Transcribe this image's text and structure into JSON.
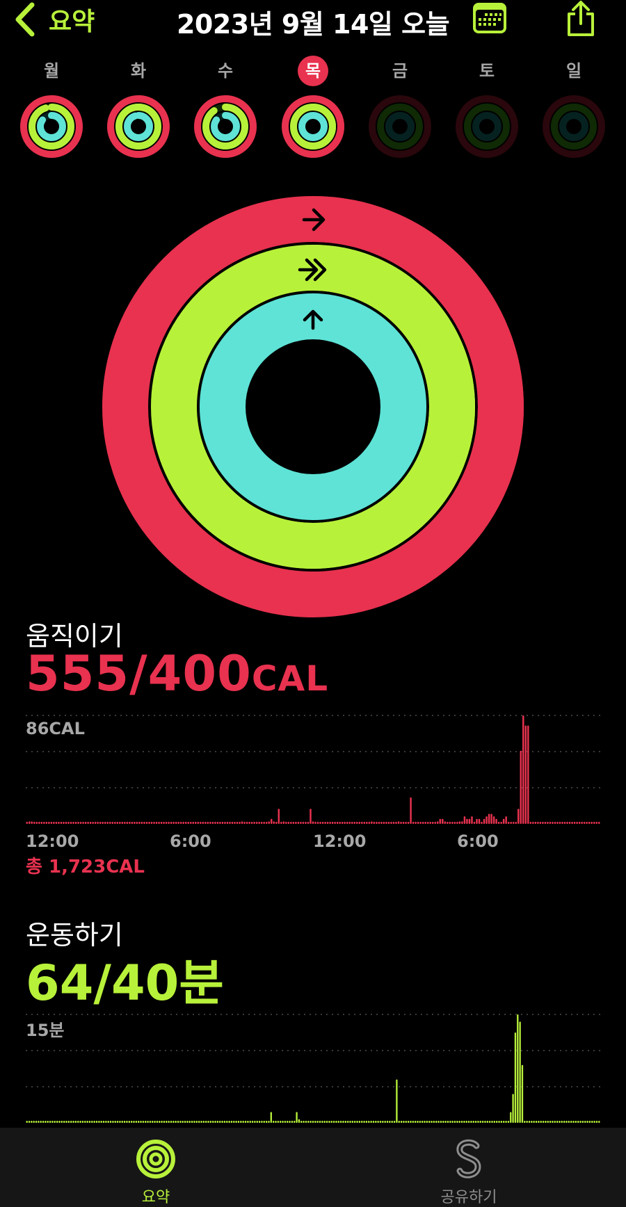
{
  "header": {
    "back_label": "요약",
    "title": "2023년 9월 14일 오늘"
  },
  "week": [
    {
      "label": "월",
      "today": false,
      "move": 1.05,
      "exercise": 0.95,
      "stand": 0.85
    },
    {
      "label": "화",
      "today": false,
      "move": 1.1,
      "exercise": 1.05,
      "stand": 0.95
    },
    {
      "label": "수",
      "today": false,
      "move": 1.05,
      "exercise": 0.9,
      "stand": 0.85
    },
    {
      "label": "목",
      "today": true,
      "move": 1.39,
      "exercise": 1.6,
      "stand": 1.0
    },
    {
      "label": "금",
      "today": false,
      "move": 0,
      "exercise": 0,
      "stand": 0
    },
    {
      "label": "토",
      "today": false,
      "move": 0,
      "exercise": 0,
      "stand": 0
    },
    {
      "label": "일",
      "today": false,
      "move": 0,
      "exercise": 0,
      "stand": 0
    }
  ],
  "rings": {
    "move": 1.39,
    "exercise": 1.6,
    "stand": 1.0
  },
  "colors": {
    "move": "#e8324f",
    "exercise": "#b8f13a",
    "stand": "#5ee3d6",
    "move_dim": "#2a070c",
    "exercise_dim": "#0f2a05",
    "stand_dim": "#062220",
    "tick_text": "#a8a8a8"
  },
  "move": {
    "label": "움직이기",
    "value": "555/400",
    "unit": "CAL",
    "chart_max_label": "86CAL",
    "ticks": [
      "12:00",
      "6:00",
      "12:00",
      "6:00"
    ],
    "total": "총 1,723CAL"
  },
  "exercise": {
    "label": "운동하기",
    "value": "64/40분",
    "chart_max_label": "15분"
  },
  "chart_data": [
    {
      "type": "bar",
      "title": "",
      "ylabel": "",
      "ymax": 86,
      "categories": [
        "12:00",
        "6:00",
        "12:00",
        "6:00"
      ],
      "values": [
        1,
        2,
        2,
        1,
        1,
        1,
        1,
        1,
        1,
        1,
        1,
        1,
        1,
        1,
        1,
        1,
        1,
        1,
        1,
        1,
        1,
        1,
        1,
        1,
        1,
        1,
        1,
        1,
        1,
        1,
        1,
        1,
        1,
        1,
        1,
        1,
        1,
        1,
        1,
        1,
        1,
        1,
        1,
        1,
        1,
        1,
        1,
        1,
        1,
        1,
        1,
        1,
        1,
        1,
        1,
        1,
        1,
        1,
        1,
        1,
        1,
        1,
        1,
        1,
        1,
        1,
        1,
        1,
        1,
        1,
        1,
        1,
        1,
        1,
        1,
        1,
        1,
        1,
        1,
        1,
        1,
        1,
        1,
        1,
        1,
        1,
        1,
        1,
        2,
        1,
        1,
        1,
        1,
        1,
        1,
        1,
        1,
        1,
        1,
        2,
        4,
        2,
        1,
        12,
        1,
        2,
        1,
        1,
        1,
        1,
        1,
        1,
        1,
        1,
        1,
        1,
        12,
        2,
        1,
        1,
        1,
        1,
        1,
        1,
        1,
        1,
        1,
        1,
        1,
        1,
        1,
        1,
        1,
        1,
        1,
        1,
        1,
        1,
        1,
        1,
        1,
        2,
        1,
        1,
        1,
        1,
        1,
        1,
        1,
        1,
        1,
        1,
        2,
        1,
        1,
        1,
        1,
        21,
        1,
        1,
        1,
        1,
        1,
        1,
        1,
        1,
        1,
        1,
        2,
        4,
        4,
        2,
        1,
        1,
        1,
        1,
        1,
        2,
        2,
        6,
        4,
        4,
        6,
        1,
        4,
        4,
        1,
        4,
        6,
        8,
        8,
        6,
        4,
        1,
        1,
        4,
        6,
        1,
        1,
        1,
        1,
        12,
        58,
        86,
        78,
        78,
        1,
        1,
        1,
        1,
        1,
        1,
        1,
        1,
        1,
        1,
        1,
        1,
        1,
        1,
        1,
        1,
        1,
        1,
        1,
        1,
        1,
        1,
        1,
        1,
        1,
        1,
        1,
        1,
        1
      ]
    },
    {
      "type": "bar",
      "title": "",
      "ylabel": "",
      "ymax": 15,
      "values": [
        0.2,
        0.2,
        0.2,
        0.2,
        0.2,
        0.2,
        0.2,
        0.2,
        0.2,
        0.2,
        0.2,
        0.2,
        0.2,
        0.2,
        0.2,
        0.2,
        0.2,
        0.2,
        0.2,
        0.2,
        0.2,
        0.2,
        0.2,
        0.2,
        0.2,
        0.2,
        0.2,
        0.2,
        0.2,
        0.2,
        0.2,
        0.2,
        0.2,
        0.2,
        0.2,
        0.2,
        0.2,
        0.2,
        0.2,
        0.2,
        0.2,
        0.2,
        0.2,
        0.2,
        0.2,
        0.2,
        0.2,
        0.2,
        0.2,
        0.2,
        0.2,
        0.2,
        0.2,
        0.2,
        0.2,
        0.2,
        0.2,
        0.2,
        0.2,
        0.2,
        0.2,
        0.2,
        0.2,
        0.2,
        0.2,
        0.2,
        0.2,
        0.2,
        0.2,
        0.2,
        0.2,
        0.2,
        0.2,
        0.2,
        0.2,
        0.2,
        0.2,
        0.2,
        0.2,
        0.2,
        0.2,
        0.2,
        0.2,
        0.2,
        0.2,
        0.2,
        0.2,
        0.2,
        0.2,
        0.2,
        0.2,
        0.2,
        0.2,
        0.2,
        0.2,
        0.2,
        0.2,
        0.2,
        0.2,
        0.2,
        0.2,
        0.2,
        0.2,
        0.2,
        0.2,
        1.5,
        0.2,
        0.2,
        0.2,
        0.2,
        0.2,
        0.2,
        0.2,
        0.2,
        0.2,
        0.2,
        1.5,
        0.5,
        0.2,
        0.2,
        0.2,
        0.2,
        0.2,
        0.2,
        0.2,
        0.2,
        0.2,
        0.2,
        0.2,
        0.2,
        0.2,
        0.2,
        0.2,
        0.2,
        0.2,
        0.2,
        0.2,
        0.2,
        0.2,
        0.2,
        0.2,
        0.2,
        0.2,
        0.2,
        0.2,
        0.2,
        0.2,
        0.2,
        0.2,
        0.2,
        0.2,
        0.2,
        0.2,
        0.2,
        0.2,
        0.2,
        0.2,
        0.2,
        0.2,
        6.0,
        0.2,
        0.2,
        0.2,
        0.2,
        0.2,
        0.2,
        0.2,
        0.2,
        0.2,
        0.2,
        0.2,
        0.2,
        0.2,
        0.2,
        0.2,
        0.2,
        0.2,
        0.2,
        0.2,
        0.2,
        0.2,
        0.2,
        0.2,
        0.2,
        0.2,
        0.2,
        0.2,
        0.2,
        0.2,
        0.2,
        0.2,
        0.2,
        0.2,
        0.2,
        0.2,
        0.2,
        0.2,
        0.2,
        0.2,
        0.2,
        0.2,
        0.2,
        0.2,
        0.2,
        0.2,
        0.2,
        0.2,
        0.2,
        1.5,
        4.0,
        12.5,
        15,
        14,
        8.0,
        0.2,
        0.2,
        0.2,
        0.2,
        0.2,
        0.2,
        0.2,
        0.2,
        0.2,
        0.2,
        0.2,
        0.2,
        0.2,
        0.2,
        0.2,
        0.2,
        0.2,
        0.2,
        0.2,
        0.2,
        0.2,
        0.2,
        0.2,
        0.2,
        0.2,
        0.2,
        0.2,
        0.2,
        0.2,
        0.2,
        0.2,
        0.2,
        0.2
      ]
    }
  ],
  "tabs": [
    {
      "label": "요약",
      "active": true,
      "color": "#b8f13a"
    },
    {
      "label": "공유하기",
      "active": false,
      "color": "#8e8e8e"
    }
  ]
}
